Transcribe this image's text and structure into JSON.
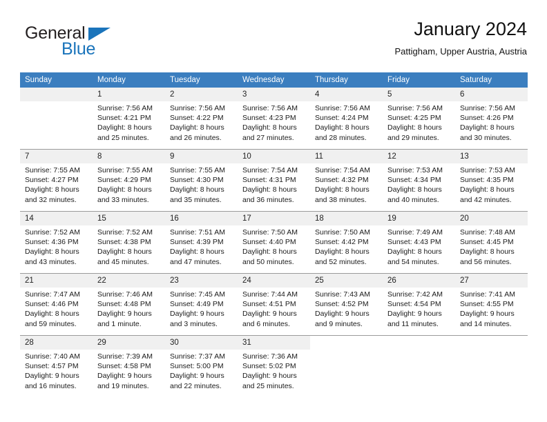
{
  "brand": {
    "name_top": "General",
    "name_bottom": "Blue",
    "triangle_icon": "triangle-icon",
    "color_dark": "#231f20",
    "color_blue": "#1a74bb"
  },
  "header": {
    "title": "January 2024",
    "subtitle": "Pattigham, Upper Austria, Austria"
  },
  "theme": {
    "header_row_bg": "#3b7ebf",
    "header_row_text": "#ffffff",
    "daynum_bg": "#f0f0f0",
    "grid_line": "#9a9a9a"
  },
  "weekdays": [
    "Sunday",
    "Monday",
    "Tuesday",
    "Wednesday",
    "Thursday",
    "Friday",
    "Saturday"
  ],
  "weeks": [
    [
      {
        "day": "",
        "sunrise": "",
        "sunset": "",
        "daylight1": "",
        "daylight2": ""
      },
      {
        "day": "1",
        "sunrise": "Sunrise: 7:56 AM",
        "sunset": "Sunset: 4:21 PM",
        "daylight1": "Daylight: 8 hours",
        "daylight2": "and 25 minutes."
      },
      {
        "day": "2",
        "sunrise": "Sunrise: 7:56 AM",
        "sunset": "Sunset: 4:22 PM",
        "daylight1": "Daylight: 8 hours",
        "daylight2": "and 26 minutes."
      },
      {
        "day": "3",
        "sunrise": "Sunrise: 7:56 AM",
        "sunset": "Sunset: 4:23 PM",
        "daylight1": "Daylight: 8 hours",
        "daylight2": "and 27 minutes."
      },
      {
        "day": "4",
        "sunrise": "Sunrise: 7:56 AM",
        "sunset": "Sunset: 4:24 PM",
        "daylight1": "Daylight: 8 hours",
        "daylight2": "and 28 minutes."
      },
      {
        "day": "5",
        "sunrise": "Sunrise: 7:56 AM",
        "sunset": "Sunset: 4:25 PM",
        "daylight1": "Daylight: 8 hours",
        "daylight2": "and 29 minutes."
      },
      {
        "day": "6",
        "sunrise": "Sunrise: 7:56 AM",
        "sunset": "Sunset: 4:26 PM",
        "daylight1": "Daylight: 8 hours",
        "daylight2": "and 30 minutes."
      }
    ],
    [
      {
        "day": "7",
        "sunrise": "Sunrise: 7:55 AM",
        "sunset": "Sunset: 4:27 PM",
        "daylight1": "Daylight: 8 hours",
        "daylight2": "and 32 minutes."
      },
      {
        "day": "8",
        "sunrise": "Sunrise: 7:55 AM",
        "sunset": "Sunset: 4:29 PM",
        "daylight1": "Daylight: 8 hours",
        "daylight2": "and 33 minutes."
      },
      {
        "day": "9",
        "sunrise": "Sunrise: 7:55 AM",
        "sunset": "Sunset: 4:30 PM",
        "daylight1": "Daylight: 8 hours",
        "daylight2": "and 35 minutes."
      },
      {
        "day": "10",
        "sunrise": "Sunrise: 7:54 AM",
        "sunset": "Sunset: 4:31 PM",
        "daylight1": "Daylight: 8 hours",
        "daylight2": "and 36 minutes."
      },
      {
        "day": "11",
        "sunrise": "Sunrise: 7:54 AM",
        "sunset": "Sunset: 4:32 PM",
        "daylight1": "Daylight: 8 hours",
        "daylight2": "and 38 minutes."
      },
      {
        "day": "12",
        "sunrise": "Sunrise: 7:53 AM",
        "sunset": "Sunset: 4:34 PM",
        "daylight1": "Daylight: 8 hours",
        "daylight2": "and 40 minutes."
      },
      {
        "day": "13",
        "sunrise": "Sunrise: 7:53 AM",
        "sunset": "Sunset: 4:35 PM",
        "daylight1": "Daylight: 8 hours",
        "daylight2": "and 42 minutes."
      }
    ],
    [
      {
        "day": "14",
        "sunrise": "Sunrise: 7:52 AM",
        "sunset": "Sunset: 4:36 PM",
        "daylight1": "Daylight: 8 hours",
        "daylight2": "and 43 minutes."
      },
      {
        "day": "15",
        "sunrise": "Sunrise: 7:52 AM",
        "sunset": "Sunset: 4:38 PM",
        "daylight1": "Daylight: 8 hours",
        "daylight2": "and 45 minutes."
      },
      {
        "day": "16",
        "sunrise": "Sunrise: 7:51 AM",
        "sunset": "Sunset: 4:39 PM",
        "daylight1": "Daylight: 8 hours",
        "daylight2": "and 47 minutes."
      },
      {
        "day": "17",
        "sunrise": "Sunrise: 7:50 AM",
        "sunset": "Sunset: 4:40 PM",
        "daylight1": "Daylight: 8 hours",
        "daylight2": "and 50 minutes."
      },
      {
        "day": "18",
        "sunrise": "Sunrise: 7:50 AM",
        "sunset": "Sunset: 4:42 PM",
        "daylight1": "Daylight: 8 hours",
        "daylight2": "and 52 minutes."
      },
      {
        "day": "19",
        "sunrise": "Sunrise: 7:49 AM",
        "sunset": "Sunset: 4:43 PM",
        "daylight1": "Daylight: 8 hours",
        "daylight2": "and 54 minutes."
      },
      {
        "day": "20",
        "sunrise": "Sunrise: 7:48 AM",
        "sunset": "Sunset: 4:45 PM",
        "daylight1": "Daylight: 8 hours",
        "daylight2": "and 56 minutes."
      }
    ],
    [
      {
        "day": "21",
        "sunrise": "Sunrise: 7:47 AM",
        "sunset": "Sunset: 4:46 PM",
        "daylight1": "Daylight: 8 hours",
        "daylight2": "and 59 minutes."
      },
      {
        "day": "22",
        "sunrise": "Sunrise: 7:46 AM",
        "sunset": "Sunset: 4:48 PM",
        "daylight1": "Daylight: 9 hours",
        "daylight2": "and 1 minute."
      },
      {
        "day": "23",
        "sunrise": "Sunrise: 7:45 AM",
        "sunset": "Sunset: 4:49 PM",
        "daylight1": "Daylight: 9 hours",
        "daylight2": "and 3 minutes."
      },
      {
        "day": "24",
        "sunrise": "Sunrise: 7:44 AM",
        "sunset": "Sunset: 4:51 PM",
        "daylight1": "Daylight: 9 hours",
        "daylight2": "and 6 minutes."
      },
      {
        "day": "25",
        "sunrise": "Sunrise: 7:43 AM",
        "sunset": "Sunset: 4:52 PM",
        "daylight1": "Daylight: 9 hours",
        "daylight2": "and 9 minutes."
      },
      {
        "day": "26",
        "sunrise": "Sunrise: 7:42 AM",
        "sunset": "Sunset: 4:54 PM",
        "daylight1": "Daylight: 9 hours",
        "daylight2": "and 11 minutes."
      },
      {
        "day": "27",
        "sunrise": "Sunrise: 7:41 AM",
        "sunset": "Sunset: 4:55 PM",
        "daylight1": "Daylight: 9 hours",
        "daylight2": "and 14 minutes."
      }
    ],
    [
      {
        "day": "28",
        "sunrise": "Sunrise: 7:40 AM",
        "sunset": "Sunset: 4:57 PM",
        "daylight1": "Daylight: 9 hours",
        "daylight2": "and 16 minutes."
      },
      {
        "day": "29",
        "sunrise": "Sunrise: 7:39 AM",
        "sunset": "Sunset: 4:58 PM",
        "daylight1": "Daylight: 9 hours",
        "daylight2": "and 19 minutes."
      },
      {
        "day": "30",
        "sunrise": "Sunrise: 7:37 AM",
        "sunset": "Sunset: 5:00 PM",
        "daylight1": "Daylight: 9 hours",
        "daylight2": "and 22 minutes."
      },
      {
        "day": "31",
        "sunrise": "Sunrise: 7:36 AM",
        "sunset": "Sunset: 5:02 PM",
        "daylight1": "Daylight: 9 hours",
        "daylight2": "and 25 minutes."
      },
      {
        "day": "",
        "sunrise": "",
        "sunset": "",
        "daylight1": "",
        "daylight2": ""
      },
      {
        "day": "",
        "sunrise": "",
        "sunset": "",
        "daylight1": "",
        "daylight2": ""
      },
      {
        "day": "",
        "sunrise": "",
        "sunset": "",
        "daylight1": "",
        "daylight2": ""
      }
    ]
  ]
}
